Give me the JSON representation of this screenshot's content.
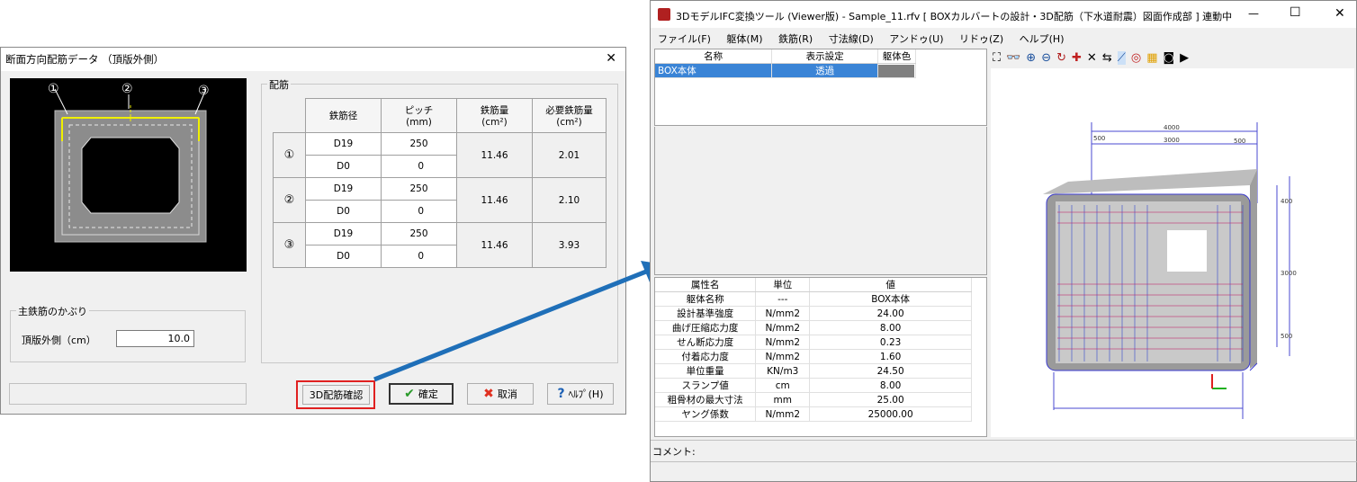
{
  "dialog": {
    "title": "断面方向配筋データ （頂版外側）",
    "markers": [
      "①",
      "②",
      "③"
    ],
    "rebar_group_title": "配筋",
    "table_headers": {
      "diameter": "鉄筋径",
      "pitch": "ピッチ",
      "pitch_unit": "(mm)",
      "amount": "鉄筋量",
      "amount_unit": "(cm²)",
      "required": "必要鉄筋量",
      "required_unit": "(cm²)"
    },
    "rows": [
      {
        "no": "①",
        "d1": "D19",
        "p1": "250",
        "d2": "D0",
        "p2": "0",
        "amount": "11.46",
        "required": "2.01"
      },
      {
        "no": "②",
        "d1": "D19",
        "p1": "250",
        "d2": "D0",
        "p2": "0",
        "amount": "11.46",
        "required": "2.10"
      },
      {
        "no": "③",
        "d1": "D19",
        "p1": "250",
        "d2": "D0",
        "p2": "0",
        "amount": "11.46",
        "required": "3.93"
      }
    ],
    "cover_group_title": "主鉄筋のかぶり",
    "cover_label": "頂版外側（cm）",
    "cover_value": "10.0",
    "btn_3d": "3D配筋確認",
    "btn_ok": "確定",
    "btn_cancel": "取消",
    "btn_help": "ﾍﾙﾌﾟ(H)",
    "close": "✕"
  },
  "viewer": {
    "title": "3DモデルIFC変換ツール (Viewer版) - Sample_11.rfv [ BOXカルバートの設計・3D配筋（下水道耐震）図面作成部 ] 連動中",
    "controls": {
      "min": "—",
      "max": "☐",
      "close": "✕"
    },
    "menu": [
      "ファイル(F)",
      "躯体(M)",
      "鉄筋(R)",
      "寸法線(D)",
      "アンドゥ(U)",
      "リドゥ(Z)",
      "ヘルプ(H)"
    ],
    "object_headers": [
      "名称",
      "表示設定",
      "躯体色"
    ],
    "object_row": {
      "name": "BOX本体",
      "display": "透過",
      "color": "#808080"
    },
    "prop_headers": [
      "属性名",
      "単位",
      "値"
    ],
    "props": [
      [
        "躯体名称",
        "---",
        "BOX本体"
      ],
      [
        "設計基準強度",
        "N/mm2",
        "24.00"
      ],
      [
        "曲げ圧縮応力度",
        "N/mm2",
        "8.00"
      ],
      [
        "せん断応力度",
        "N/mm2",
        "0.23"
      ],
      [
        "付着応力度",
        "N/mm2",
        "1.60"
      ],
      [
        "単位重量",
        "KN/m3",
        "24.50"
      ],
      [
        "スランプ値",
        "cm",
        "8.00"
      ],
      [
        "粗骨材の最大寸法",
        "mm",
        "25.00"
      ],
      [
        "ヤング係数",
        "N/mm2",
        "25000.00"
      ]
    ],
    "comment_label": "コメント:",
    "dims": {
      "top_total": "4000",
      "top_inner": "3000",
      "top_left": "500",
      "top_right": "500",
      "side_top": "400",
      "side_mid": "3000",
      "side_bot": "500"
    }
  },
  "colors": {
    "selection": "#3a84d6",
    "arrow": "#1f6fb8",
    "highlight": "#e02020"
  }
}
